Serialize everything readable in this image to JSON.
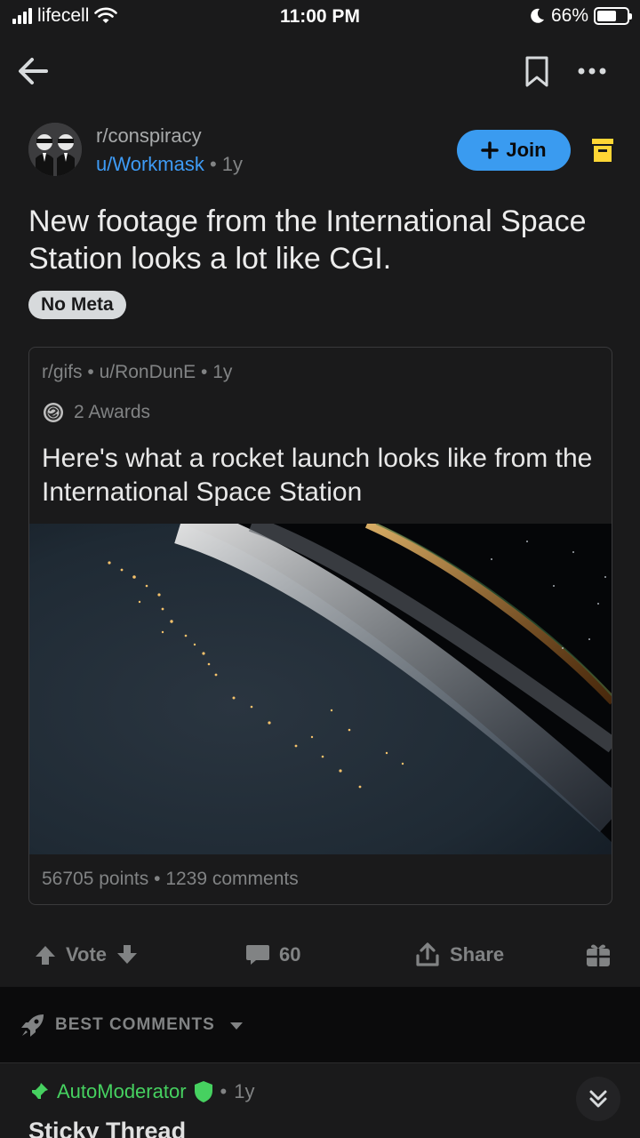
{
  "status_bar": {
    "carrier": "lifecell",
    "time": "11:00 PM",
    "battery": "66%",
    "battery_level": 0.66
  },
  "nav": {
    "back_icon": "arrow-left-icon",
    "bookmark_icon": "bookmark-icon",
    "more_icon": "more-horizontal-icon"
  },
  "post": {
    "subreddit": "r/conspiracy",
    "author": "u/Workmask",
    "separator": "•",
    "age": "1y",
    "join_label": "Join",
    "title": "New footage from the International Space Station looks a lot like CGI.",
    "flair": "No Meta"
  },
  "crosspost": {
    "subreddit": "r/gifs",
    "author": "u/RonDunE",
    "age": "1y",
    "awards": "2 Awards",
    "title": "Here's what a rocket launch looks like from the International Space Station",
    "points": "56705 points",
    "comments": "1239 comments"
  },
  "actions": {
    "vote_label": "Vote",
    "comment_count": "60",
    "share_label": "Share"
  },
  "comments": {
    "sort_label": "BEST COMMENTS",
    "first": {
      "author": "AutoModerator",
      "age": "1y",
      "title": "Sticky Thread"
    }
  },
  "colors": {
    "background": "#1a1a1b",
    "accent_blue": "#3a9bf0",
    "moderator_green": "#46d160",
    "archive_yellow": "#ffd635"
  }
}
